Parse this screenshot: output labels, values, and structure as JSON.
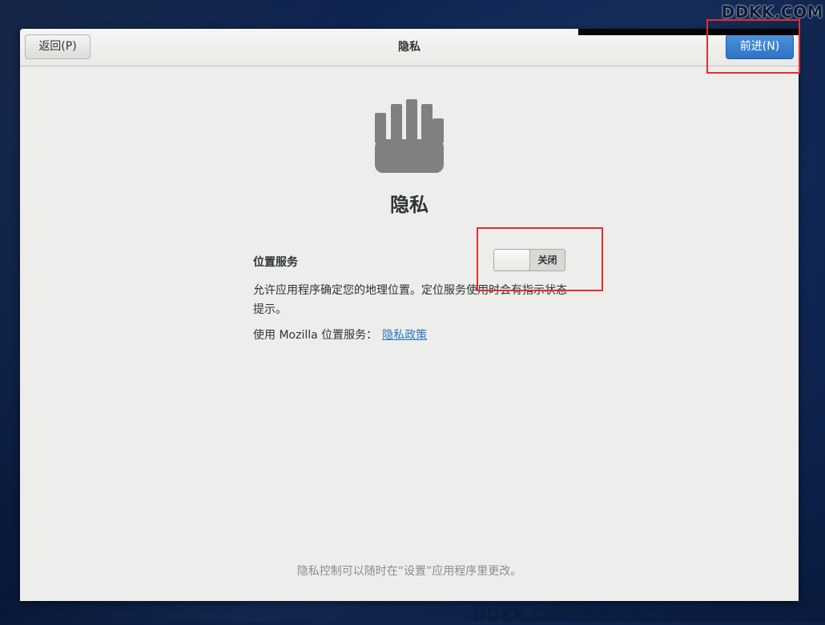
{
  "header": {
    "back_label": "返回(P)",
    "title": "隐私",
    "next_label": "前进(N)"
  },
  "main": {
    "icon": "privacy-hand-icon",
    "heading": "隐私",
    "location_label": "位置服务",
    "location_switch_state": "关闭",
    "location_switch_on": false,
    "description": "允许应用程序确定您的地理位置。定位服务使用时会有指示状态提示。",
    "mozilla_text": "使用 Mozilla 位置服务：",
    "policy_link": "隐私政策",
    "footer_note": "隐私控制可以随时在“设置”应用程序里更改。"
  },
  "watermark": {
    "top": "DDKK.COM",
    "bottom": "DDKK.COM 弟弟快看，程序员编程资料站"
  },
  "colors": {
    "accent_button": "#3584e4",
    "link": "#2a76c6",
    "annotation": "#e52d2d",
    "window_bg": "#ededeb"
  }
}
